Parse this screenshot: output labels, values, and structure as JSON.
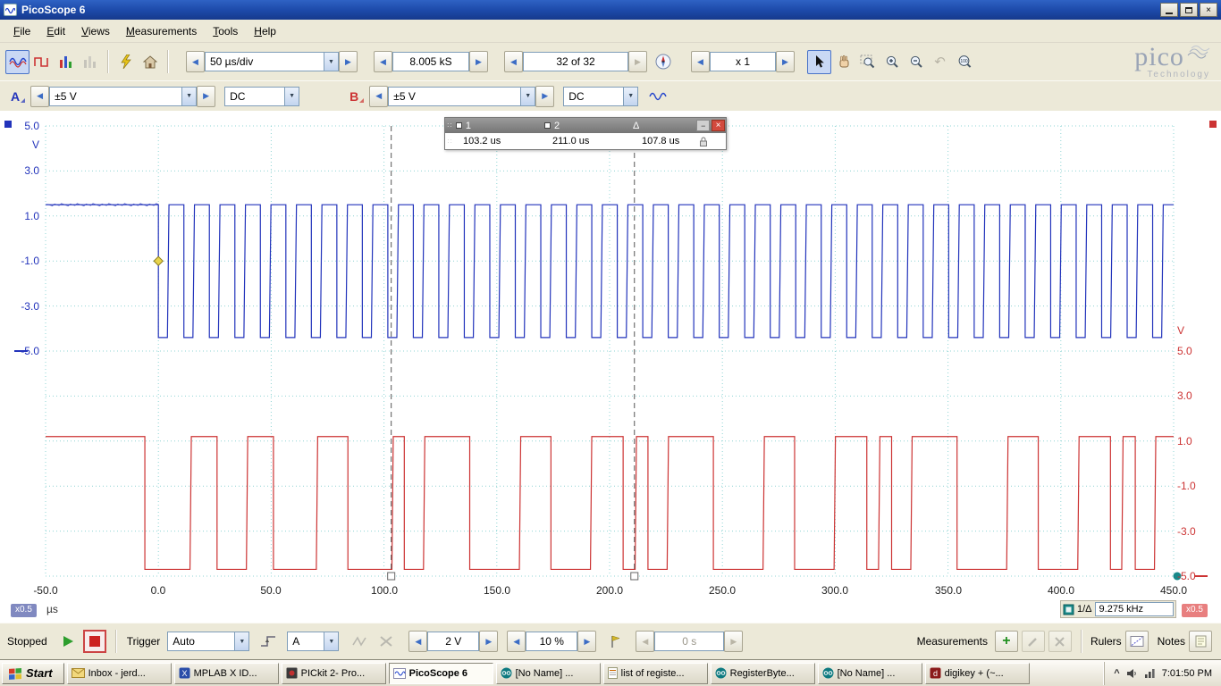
{
  "window": {
    "title": "PicoScope 6"
  },
  "menu": {
    "items": [
      "File",
      "Edit",
      "Views",
      "Measurements",
      "Tools",
      "Help"
    ]
  },
  "icons": {
    "spin_left": "◀",
    "spin_right": "▶",
    "dropdown": "▼",
    "minimize": "−",
    "close": "×",
    "undo": "↶",
    "tray_chevron": "^",
    "grip": "∷"
  },
  "toolbar": {
    "timebase": "50 µs/div",
    "samples": "8.005 kS",
    "buffer": "32 of 32",
    "zoom": "x 1",
    "zoom_reset": "100",
    "logo": {
      "name": "pico",
      "sub": "Technology"
    }
  },
  "channels": {
    "a": {
      "label": "A",
      "range": "±5 V",
      "coupling": "DC"
    },
    "b": {
      "label": "B",
      "range": "±5 V",
      "coupling": "DC"
    }
  },
  "ruler_box": {
    "h1": "1",
    "h2": "2",
    "hd": "Δ",
    "v1": "103.2 us",
    "v2": "211.0 us",
    "vd": "107.8 us"
  },
  "scope": {
    "left_axis": {
      "unit": "V",
      "labels": [
        "5.0",
        "3.0",
        "1.0",
        "-1.0",
        "-3.0",
        "-5.0"
      ]
    },
    "right_axis": {
      "unit": "V",
      "labels": [
        "5.0",
        "3.0",
        "1.0",
        "-1.0",
        "-3.0",
        "-5.0"
      ]
    },
    "x_labels": [
      "-50.0",
      "0.0",
      "50.0",
      "100.0",
      "150.0",
      "200.0",
      "250.0",
      "300.0",
      "350.0",
      "400.0",
      "450.0"
    ],
    "x_unit": "µs",
    "left_badge": "x0.5",
    "right_badge": "x0.5",
    "freq_label": "1/Δ",
    "freq_value": "9.275 kHz"
  },
  "chart_data": {
    "type": "line",
    "x_unit": "µs",
    "x_range": [
      -50.0,
      450.0
    ],
    "x_tick_step": 50.0,
    "y_volts_full_scale": [
      -5.0,
      5.0
    ],
    "display_scale": "x0.5",
    "series": [
      {
        "name": "Channel A",
        "color": "#2233bb",
        "position": "top-half",
        "high_v": 3.25,
        "low_v": 0.3,
        "pattern": {
          "kind": "pulse-train",
          "initial_high_until": 0,
          "low_time": 4.0,
          "period": 11.3,
          "end": 450
        }
      },
      {
        "name": "Channel B",
        "color": "#cc3333",
        "position": "bottom-half",
        "high_v": 3.1,
        "low_v": 0.15,
        "high_segments": [
          [
            -50,
            -6
          ],
          [
            14,
            26
          ],
          [
            39,
            51
          ],
          [
            70,
            84
          ],
          [
            103.5,
            109
          ],
          [
            117.5,
            138
          ],
          [
            160,
            174
          ],
          [
            191.5,
            206
          ],
          [
            211.3,
            217
          ],
          [
            225.5,
            246
          ],
          [
            268,
            282
          ],
          [
            299.5,
            314
          ],
          [
            319.2,
            325
          ],
          [
            333.5,
            354
          ],
          [
            376,
            390
          ],
          [
            407.5,
            422
          ],
          [
            427,
            433
          ],
          [
            441.5,
            450
          ]
        ]
      }
    ],
    "time_rulers": {
      "t1_us": 103.2,
      "t2_us": 211.0,
      "delta_us": 107.8,
      "frequency": "9.275 kHz"
    },
    "trigger": {
      "source": "A",
      "level_v": 2.0,
      "time_us": 0.0
    }
  },
  "controls": {
    "status": "Stopped",
    "trigger_label": "Trigger",
    "trigger_mode": "Auto",
    "trigger_source": "A",
    "trigger_level": "2 V",
    "pretrigger": "10 %",
    "holdoff": "0 s",
    "measurements_label": "Measurements",
    "rulers_label": "Rulers",
    "notes_label": "Notes"
  },
  "taskbar": {
    "start": "Start",
    "items": [
      {
        "label": "Inbox - jerd..."
      },
      {
        "label": "MPLAB X ID..."
      },
      {
        "label": "PICkit 2- Pro..."
      },
      {
        "label": "PicoScope 6"
      },
      {
        "label": "[No Name] ..."
      },
      {
        "label": "list of registe..."
      },
      {
        "label": "RegisterByte..."
      },
      {
        "label": "[No Name] ..."
      },
      {
        "label": "digikey + (~..."
      }
    ],
    "clock": "7:01:50 PM"
  }
}
